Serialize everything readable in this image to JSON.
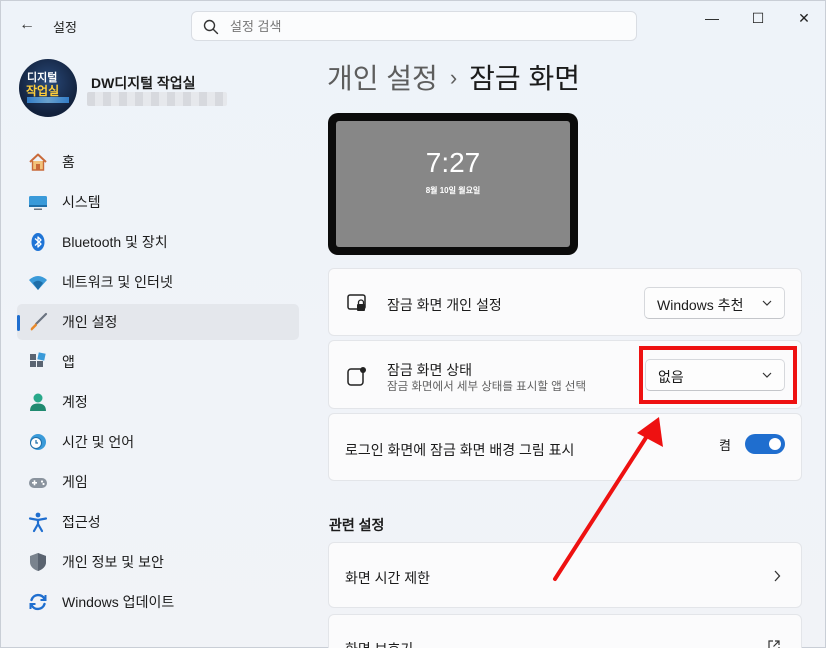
{
  "window": {
    "app_title": "설정",
    "back": "←",
    "controls": {
      "minimize": "—",
      "maximize": "☐",
      "close": "✕"
    }
  },
  "search": {
    "placeholder": "설정 검색",
    "value": ""
  },
  "profile": {
    "name": "DW디지털 작업실",
    "avatar_text_top": "디지털",
    "avatar_text_bottom": "작업실"
  },
  "sidebar": {
    "items": [
      {
        "label": "홈",
        "icon": "home-icon",
        "selected": false
      },
      {
        "label": "시스템",
        "icon": "display-icon",
        "selected": false
      },
      {
        "label": "Bluetooth 및 장치",
        "icon": "bluetooth-icon",
        "selected": false
      },
      {
        "label": "네트워크 및 인터넷",
        "icon": "wifi-icon",
        "selected": false
      },
      {
        "label": "개인 설정",
        "icon": "brush-icon",
        "selected": true
      },
      {
        "label": "앱",
        "icon": "apps-icon",
        "selected": false
      },
      {
        "label": "계정",
        "icon": "person-icon",
        "selected": false
      },
      {
        "label": "시간 및 언어",
        "icon": "clock-globe-icon",
        "selected": false
      },
      {
        "label": "게임",
        "icon": "gamepad-icon",
        "selected": false
      },
      {
        "label": "접근성",
        "icon": "accessibility-icon",
        "selected": false
      },
      {
        "label": "개인 정보 및 보안",
        "icon": "shield-icon",
        "selected": false
      },
      {
        "label": "Windows 업데이트",
        "icon": "update-icon",
        "selected": false
      }
    ]
  },
  "breadcrumb": {
    "parent": "개인 설정",
    "separator": "›",
    "current": "잠금 화면"
  },
  "preview": {
    "time": "7:27",
    "date": "8월 10일 월요일"
  },
  "settings": {
    "personalize": {
      "title": "잠금 화면 개인 설정",
      "value": "Windows 추천",
      "icon": "lock-screen-icon"
    },
    "status": {
      "title": "잠금 화면 상태",
      "subtitle": "잠금 화면에서 세부 상태를 표시할 앱 선택",
      "value": "없음",
      "icon": "status-icon"
    },
    "signin_bg": {
      "title": "로그인 화면에 잠금 화면 배경 그림 표시",
      "state_label": "켬",
      "on": true
    }
  },
  "related": {
    "heading": "관련 설정",
    "items": [
      {
        "label": "화면 시간 제한",
        "icon": "chevron-right-icon"
      },
      {
        "label": "화면 보호기",
        "icon": "external-link-icon"
      }
    ]
  },
  "colors": {
    "accent": "#1f6ecf",
    "annotation": "#ee1111"
  }
}
